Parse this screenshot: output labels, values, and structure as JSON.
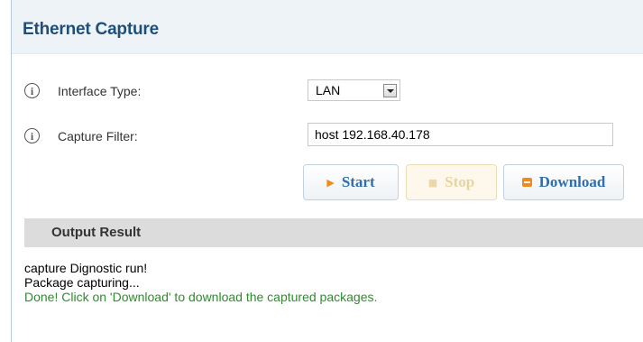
{
  "header": {
    "title": "Ethernet Capture"
  },
  "form": {
    "interface_type": {
      "label": "Interface Type:",
      "value": "LAN"
    },
    "capture_filter": {
      "label": "Capture Filter:",
      "value": "host 192.168.40.178"
    }
  },
  "buttons": {
    "start": "Start",
    "stop": "Stop",
    "download": "Download"
  },
  "output": {
    "title": "Output Result",
    "lines": [
      "capture Dignostic run!",
      "Package capturing...",
      "Done! Click on 'Download' to download the captured packages."
    ]
  },
  "colors": {
    "title": "#1f4e79",
    "accent_icon": "#f08a1c",
    "success_text": "#2e8b2e",
    "disabled_button_text": "#e8d3a2"
  },
  "icons": {
    "info": "info-circle-icon",
    "start": "play-icon",
    "stop": "stop-icon",
    "download": "download-icon"
  }
}
